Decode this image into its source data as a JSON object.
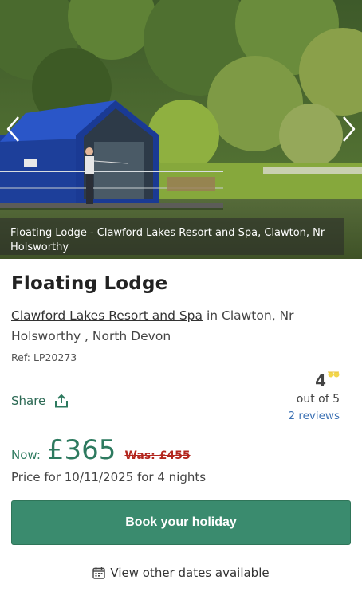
{
  "gallery": {
    "image_alt": "Floating lodge on a lake with a man fishing from the deck",
    "caption": "Floating Lodge - Clawford Lakes Resort and Spa, Clawton, Nr Holsworthy",
    "prev_icon": "chevron-left-icon",
    "next_icon": "chevron-right-icon"
  },
  "property": {
    "title": "Floating Lodge",
    "resort_link": "Clawford Lakes Resort and Spa",
    "location_rest": " in Clawton, Nr Holsworthy , North Devon",
    "ref": "Ref: LP20273"
  },
  "share": {
    "label": "Share",
    "icon": "share-icon"
  },
  "rating": {
    "score": "4",
    "out_of": "out of 5",
    "reviews": "2 reviews",
    "icon": "sun-rating-icon"
  },
  "pricing": {
    "now_label": "Now:",
    "now_price": "£365",
    "was_price": "Was: £455",
    "price_for": "Price for 10/11/2025 for 4 nights"
  },
  "actions": {
    "book_label": "Book your holiday",
    "other_dates_label": "View other dates available",
    "calendar_icon": "calendar-icon"
  },
  "colors": {
    "accent_green": "#3a8b6e",
    "price_green": "#2d7a5f",
    "was_red": "#b3261e",
    "link_blue": "#3d72b4"
  }
}
